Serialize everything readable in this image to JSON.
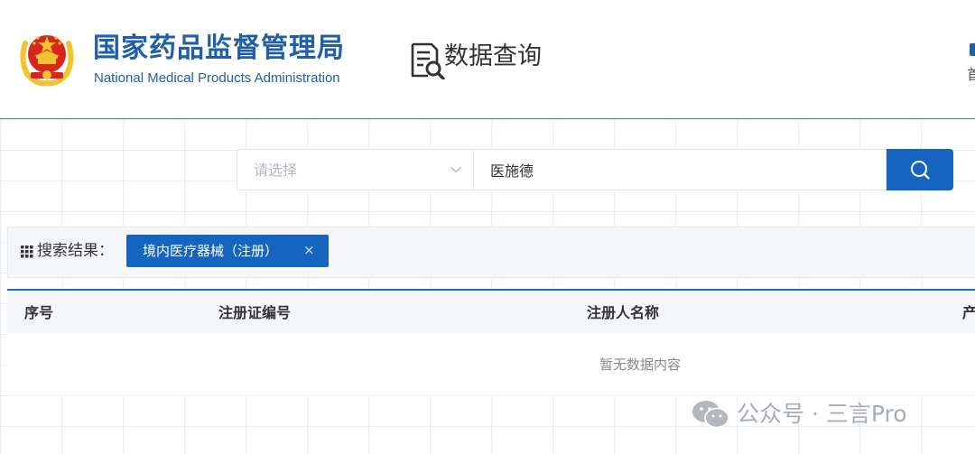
{
  "header": {
    "org_name_cn": "国家药品监督管理局",
    "org_name_en": "National Medical Products Administration",
    "section_title": "数据查询",
    "right_link_partial": "首",
    "emblem_icon": "national-emblem-icon",
    "section_icon": "document-search-icon"
  },
  "search": {
    "category_placeholder": "请选择",
    "query_value": "医施德",
    "button_icon": "search-icon"
  },
  "results": {
    "label": "搜索结果：",
    "filter_tag": {
      "label": "境内医疗器械（注册）",
      "close_symbol": "×"
    }
  },
  "table": {
    "columns": [
      "序号",
      "注册证编号",
      "注册人名称",
      "产"
    ],
    "empty_message": "暂无数据内容"
  },
  "watermark": {
    "text": "公众号 · 三言Pro",
    "icon": "wechat-icon"
  },
  "colors": {
    "brand_blue": "#1565c0",
    "header_text_blue": "#1f5fa8",
    "emblem_red": "#d7261e",
    "emblem_gold": "#f3c330"
  }
}
